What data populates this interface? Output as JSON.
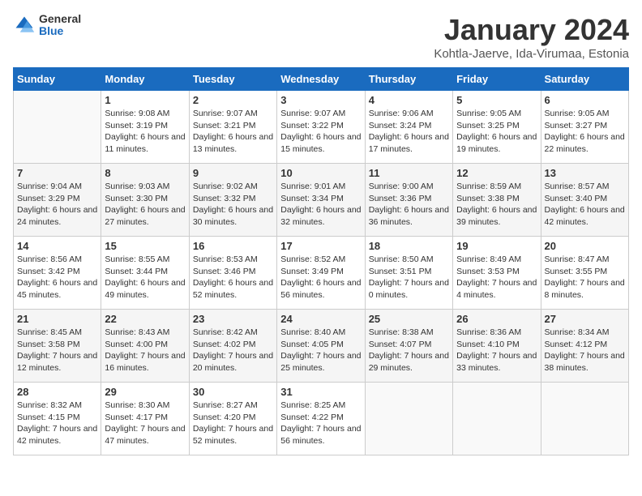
{
  "header": {
    "logo_general": "General",
    "logo_blue": "Blue",
    "month_title": "January 2024",
    "location": "Kohtla-Jaerve, Ida-Virumaa, Estonia"
  },
  "days_of_week": [
    "Sunday",
    "Monday",
    "Tuesday",
    "Wednesday",
    "Thursday",
    "Friday",
    "Saturday"
  ],
  "weeks": [
    [
      {
        "day": "",
        "sunrise": "",
        "sunset": "",
        "daylight": ""
      },
      {
        "day": "1",
        "sunrise": "Sunrise: 9:08 AM",
        "sunset": "Sunset: 3:19 PM",
        "daylight": "Daylight: 6 hours and 11 minutes."
      },
      {
        "day": "2",
        "sunrise": "Sunrise: 9:07 AM",
        "sunset": "Sunset: 3:21 PM",
        "daylight": "Daylight: 6 hours and 13 minutes."
      },
      {
        "day": "3",
        "sunrise": "Sunrise: 9:07 AM",
        "sunset": "Sunset: 3:22 PM",
        "daylight": "Daylight: 6 hours and 15 minutes."
      },
      {
        "day": "4",
        "sunrise": "Sunrise: 9:06 AM",
        "sunset": "Sunset: 3:24 PM",
        "daylight": "Daylight: 6 hours and 17 minutes."
      },
      {
        "day": "5",
        "sunrise": "Sunrise: 9:05 AM",
        "sunset": "Sunset: 3:25 PM",
        "daylight": "Daylight: 6 hours and 19 minutes."
      },
      {
        "day": "6",
        "sunrise": "Sunrise: 9:05 AM",
        "sunset": "Sunset: 3:27 PM",
        "daylight": "Daylight: 6 hours and 22 minutes."
      }
    ],
    [
      {
        "day": "7",
        "sunrise": "Sunrise: 9:04 AM",
        "sunset": "Sunset: 3:29 PM",
        "daylight": "Daylight: 6 hours and 24 minutes."
      },
      {
        "day": "8",
        "sunrise": "Sunrise: 9:03 AM",
        "sunset": "Sunset: 3:30 PM",
        "daylight": "Daylight: 6 hours and 27 minutes."
      },
      {
        "day": "9",
        "sunrise": "Sunrise: 9:02 AM",
        "sunset": "Sunset: 3:32 PM",
        "daylight": "Daylight: 6 hours and 30 minutes."
      },
      {
        "day": "10",
        "sunrise": "Sunrise: 9:01 AM",
        "sunset": "Sunset: 3:34 PM",
        "daylight": "Daylight: 6 hours and 32 minutes."
      },
      {
        "day": "11",
        "sunrise": "Sunrise: 9:00 AM",
        "sunset": "Sunset: 3:36 PM",
        "daylight": "Daylight: 6 hours and 36 minutes."
      },
      {
        "day": "12",
        "sunrise": "Sunrise: 8:59 AM",
        "sunset": "Sunset: 3:38 PM",
        "daylight": "Daylight: 6 hours and 39 minutes."
      },
      {
        "day": "13",
        "sunrise": "Sunrise: 8:57 AM",
        "sunset": "Sunset: 3:40 PM",
        "daylight": "Daylight: 6 hours and 42 minutes."
      }
    ],
    [
      {
        "day": "14",
        "sunrise": "Sunrise: 8:56 AM",
        "sunset": "Sunset: 3:42 PM",
        "daylight": "Daylight: 6 hours and 45 minutes."
      },
      {
        "day": "15",
        "sunrise": "Sunrise: 8:55 AM",
        "sunset": "Sunset: 3:44 PM",
        "daylight": "Daylight: 6 hours and 49 minutes."
      },
      {
        "day": "16",
        "sunrise": "Sunrise: 8:53 AM",
        "sunset": "Sunset: 3:46 PM",
        "daylight": "Daylight: 6 hours and 52 minutes."
      },
      {
        "day": "17",
        "sunrise": "Sunrise: 8:52 AM",
        "sunset": "Sunset: 3:49 PM",
        "daylight": "Daylight: 6 hours and 56 minutes."
      },
      {
        "day": "18",
        "sunrise": "Sunrise: 8:50 AM",
        "sunset": "Sunset: 3:51 PM",
        "daylight": "Daylight: 7 hours and 0 minutes."
      },
      {
        "day": "19",
        "sunrise": "Sunrise: 8:49 AM",
        "sunset": "Sunset: 3:53 PM",
        "daylight": "Daylight: 7 hours and 4 minutes."
      },
      {
        "day": "20",
        "sunrise": "Sunrise: 8:47 AM",
        "sunset": "Sunset: 3:55 PM",
        "daylight": "Daylight: 7 hours and 8 minutes."
      }
    ],
    [
      {
        "day": "21",
        "sunrise": "Sunrise: 8:45 AM",
        "sunset": "Sunset: 3:58 PM",
        "daylight": "Daylight: 7 hours and 12 minutes."
      },
      {
        "day": "22",
        "sunrise": "Sunrise: 8:43 AM",
        "sunset": "Sunset: 4:00 PM",
        "daylight": "Daylight: 7 hours and 16 minutes."
      },
      {
        "day": "23",
        "sunrise": "Sunrise: 8:42 AM",
        "sunset": "Sunset: 4:02 PM",
        "daylight": "Daylight: 7 hours and 20 minutes."
      },
      {
        "day": "24",
        "sunrise": "Sunrise: 8:40 AM",
        "sunset": "Sunset: 4:05 PM",
        "daylight": "Daylight: 7 hours and 25 minutes."
      },
      {
        "day": "25",
        "sunrise": "Sunrise: 8:38 AM",
        "sunset": "Sunset: 4:07 PM",
        "daylight": "Daylight: 7 hours and 29 minutes."
      },
      {
        "day": "26",
        "sunrise": "Sunrise: 8:36 AM",
        "sunset": "Sunset: 4:10 PM",
        "daylight": "Daylight: 7 hours and 33 minutes."
      },
      {
        "day": "27",
        "sunrise": "Sunrise: 8:34 AM",
        "sunset": "Sunset: 4:12 PM",
        "daylight": "Daylight: 7 hours and 38 minutes."
      }
    ],
    [
      {
        "day": "28",
        "sunrise": "Sunrise: 8:32 AM",
        "sunset": "Sunset: 4:15 PM",
        "daylight": "Daylight: 7 hours and 42 minutes."
      },
      {
        "day": "29",
        "sunrise": "Sunrise: 8:30 AM",
        "sunset": "Sunset: 4:17 PM",
        "daylight": "Daylight: 7 hours and 47 minutes."
      },
      {
        "day": "30",
        "sunrise": "Sunrise: 8:27 AM",
        "sunset": "Sunset: 4:20 PM",
        "daylight": "Daylight: 7 hours and 52 minutes."
      },
      {
        "day": "31",
        "sunrise": "Sunrise: 8:25 AM",
        "sunset": "Sunset: 4:22 PM",
        "daylight": "Daylight: 7 hours and 56 minutes."
      },
      {
        "day": "",
        "sunrise": "",
        "sunset": "",
        "daylight": ""
      },
      {
        "day": "",
        "sunrise": "",
        "sunset": "",
        "daylight": ""
      },
      {
        "day": "",
        "sunrise": "",
        "sunset": "",
        "daylight": ""
      }
    ]
  ]
}
